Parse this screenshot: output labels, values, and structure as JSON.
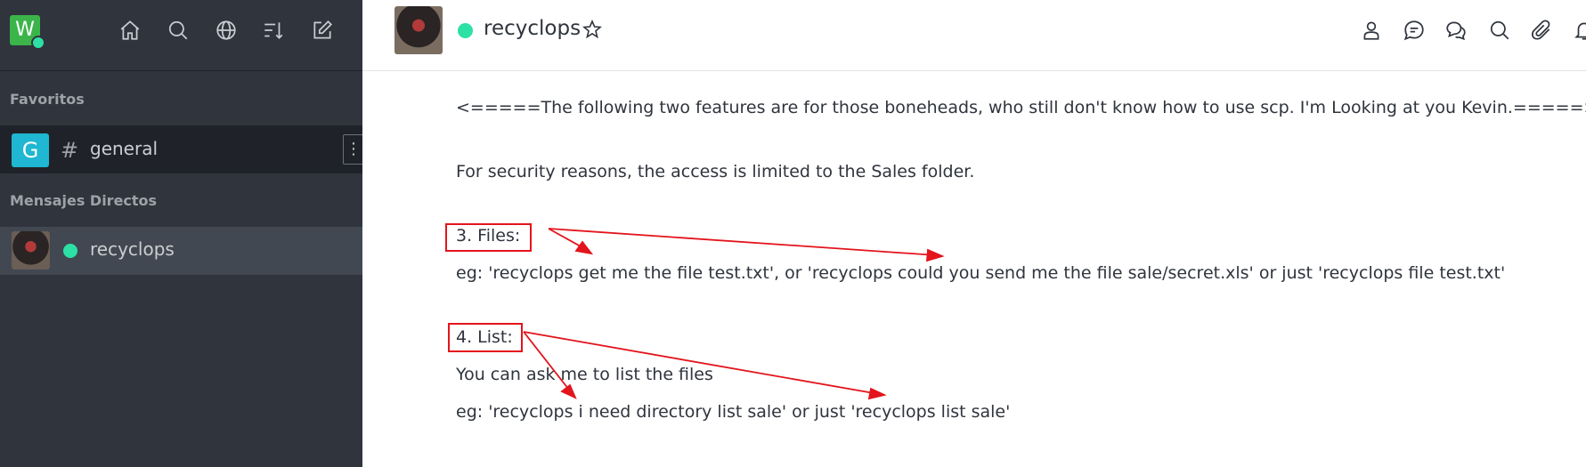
{
  "workspace": {
    "logo_letter": "W"
  },
  "sidebar": {
    "toolbar_icons": [
      "home-icon",
      "search-icon",
      "directory-globe-icon",
      "sort-icon",
      "create-new-icon"
    ],
    "favorites_title": "Favoritos",
    "channel": {
      "avatar_letter": "G",
      "prefix": "#",
      "name": "general"
    },
    "direct_title": "Mensajes Directos",
    "dm": {
      "name": "recyclops"
    }
  },
  "header": {
    "room_name": "recyclops",
    "icons": [
      "user-info-icon",
      "threads-icon",
      "discussion-icon",
      "search-messages-icon",
      "attachment-icon",
      "notifications-icon"
    ]
  },
  "messages": {
    "line1": "<=====The following two features are for those boneheads, who still don't know how to use scp. I'm Looking at you Kevin.=====>",
    "line2": "For security reasons, the access is limited to the Sales folder.",
    "files_heading": "3. Files:",
    "files_example": "eg: 'recyclops get me the file test.txt', or 'recyclops could you send me the file sale/secret.xls' or just 'recyclops file test.txt'",
    "list_heading": "4. List:",
    "list_desc": "You can ask me to list the files",
    "list_example": "eg: 'recyclops i need directory list sale' or just 'recyclops list sale'"
  },
  "annotation_color": "#e3141b",
  "accent_online": "#2de0a5"
}
